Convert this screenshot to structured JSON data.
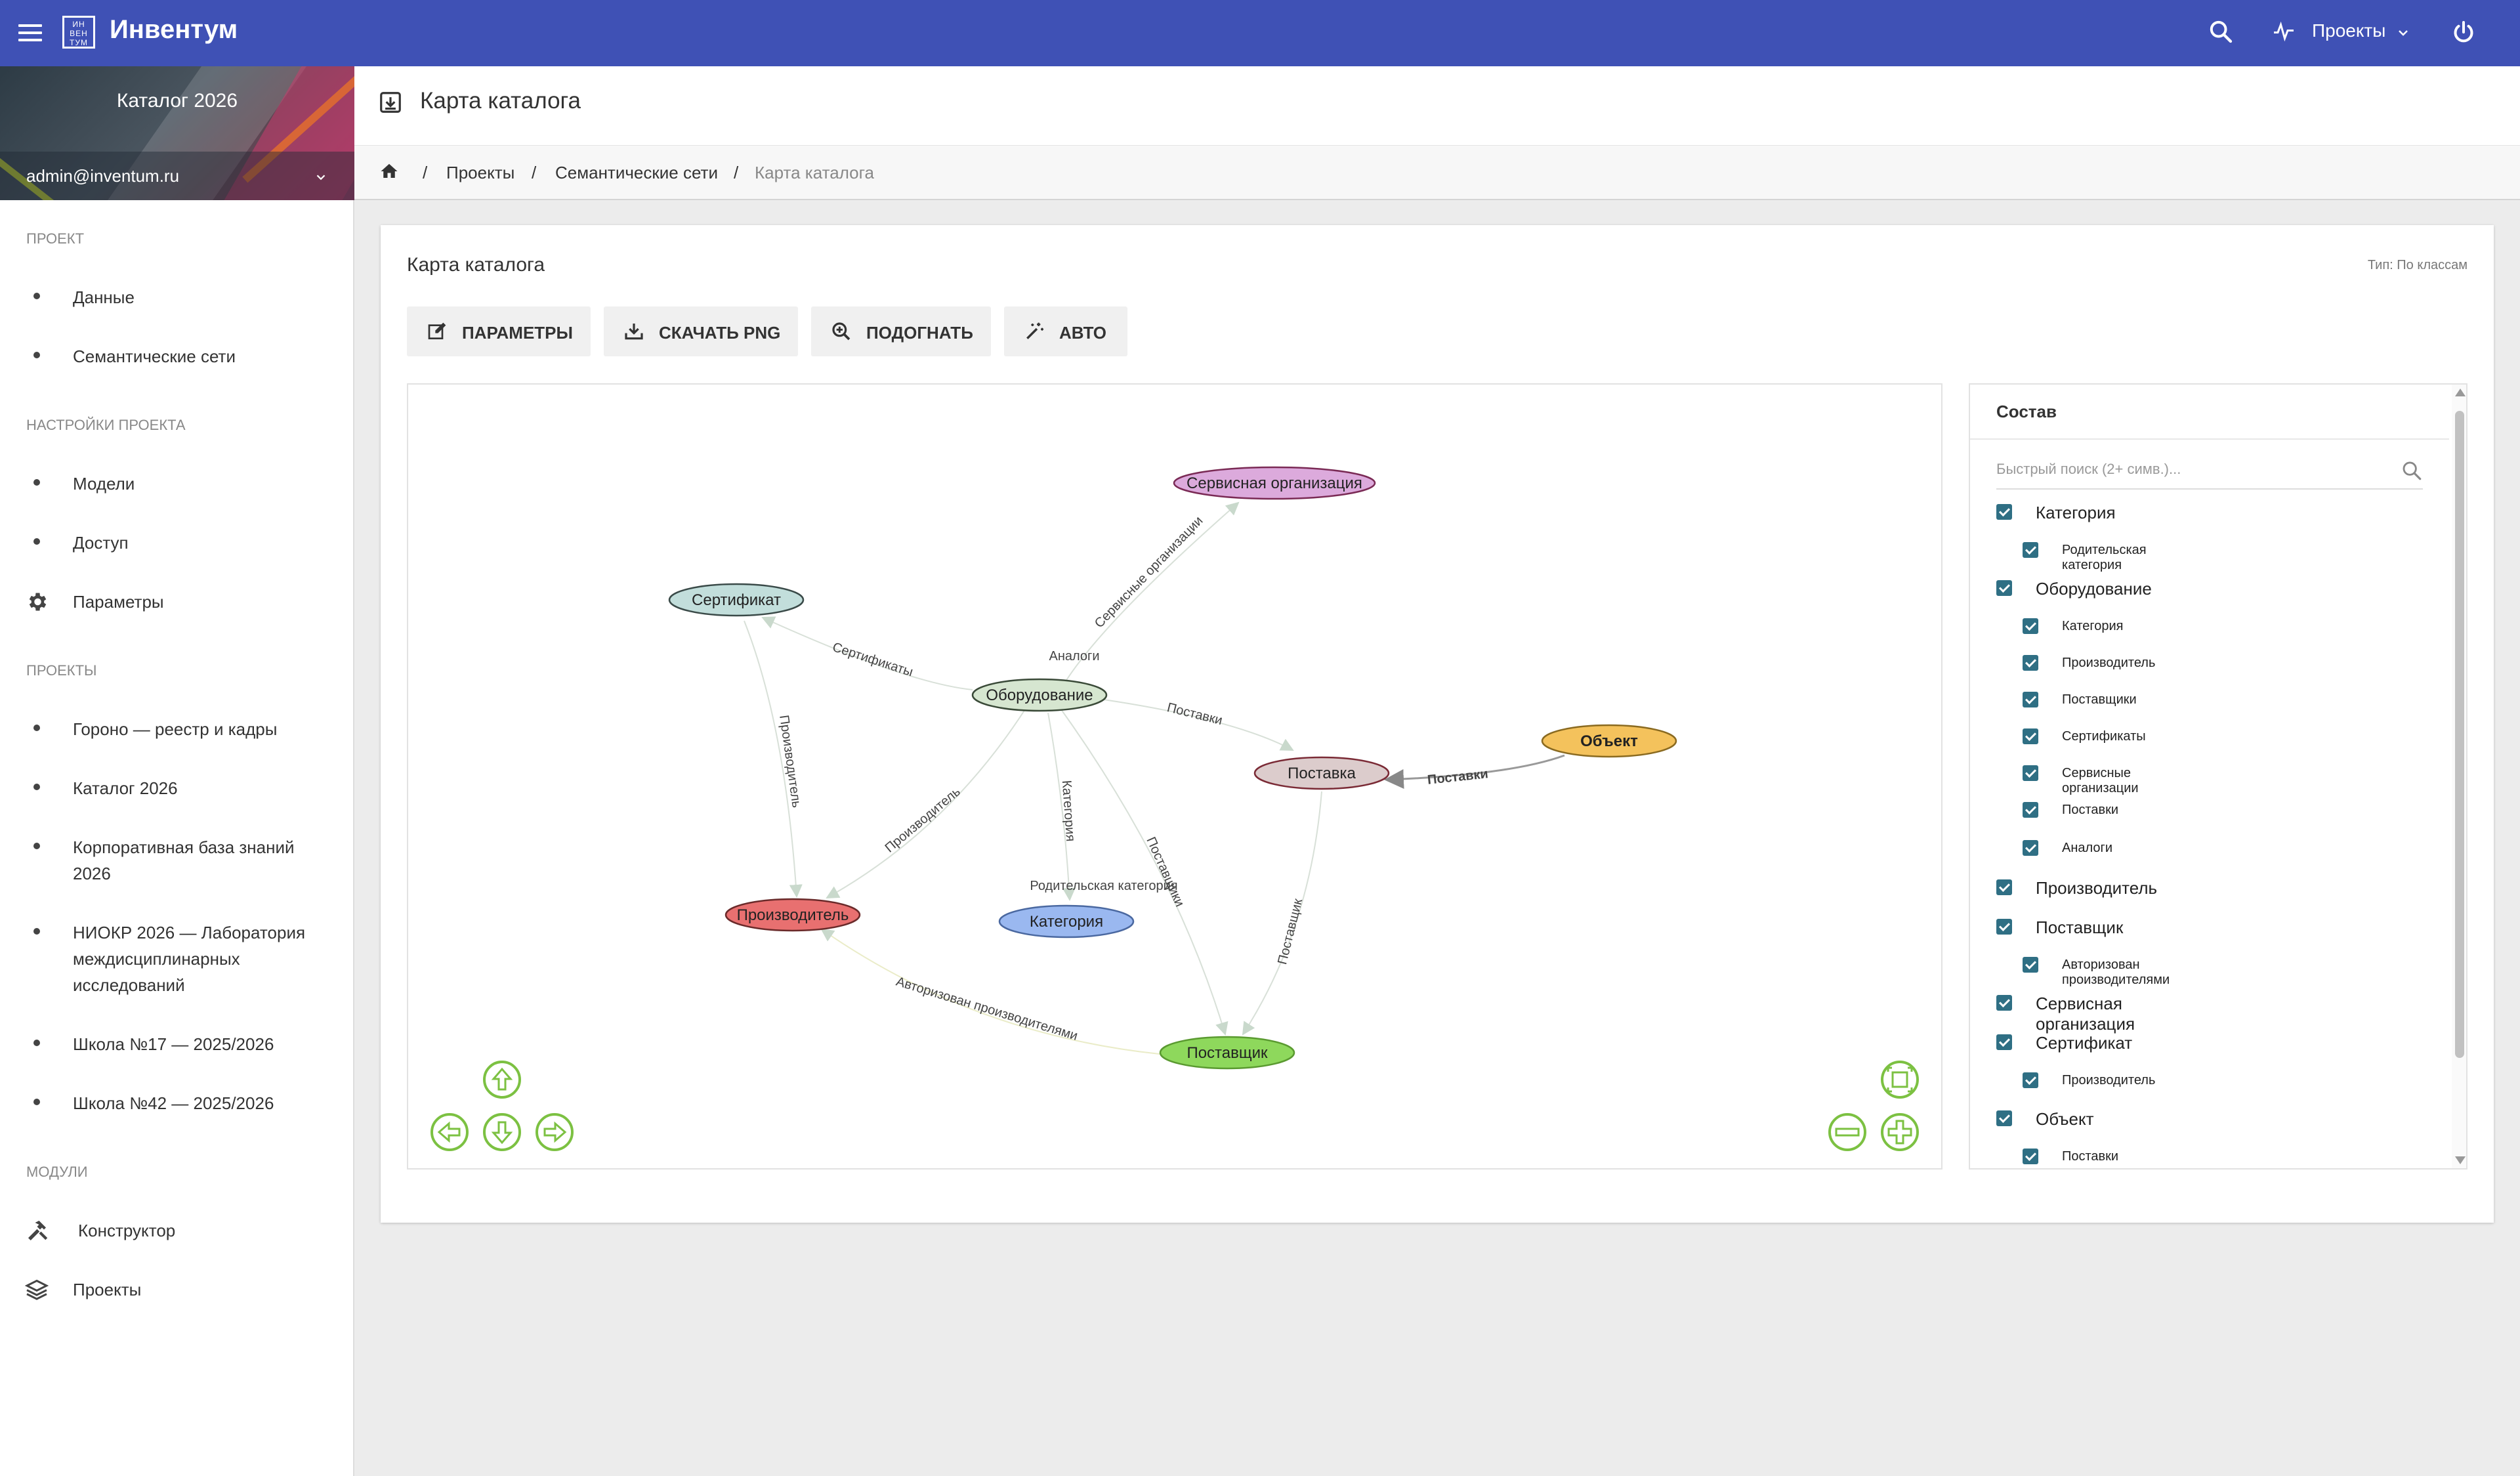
{
  "app": {
    "brand": "Инвентум",
    "logo_text": "ИН ВЕН ТУМ",
    "projects_label": "Проекты"
  },
  "sidebar": {
    "project_name": "Каталог 2026",
    "user_email": "admin@inventum.ru",
    "section_project": "Проект",
    "project_items": [
      "Данные",
      "Семантические сети"
    ],
    "section_settings": "Настройки проекта",
    "settings_items": [
      "Модели",
      "Доступ",
      "Параметры"
    ],
    "section_projects": "Проекты",
    "projects": [
      "Гороно — реестр и кадры",
      "Каталог 2026",
      "Корпоративная база знаний 2026",
      "НИОКР 2026 — Лаборатория междисциплинарных исследований",
      "Школа №17 — 2025/2026",
      "Школа №42 — 2025/2026"
    ],
    "section_modules": "Модули",
    "modules": [
      "Конструктор",
      "Проекты"
    ]
  },
  "page": {
    "title": "Карта каталога",
    "breadcrumbs": [
      "Проекты",
      "Семантические сети",
      "Карта каталога"
    ]
  },
  "card": {
    "title": "Карта каталога",
    "type_label": "Тип: По классам",
    "buttons": {
      "params": "Параметры",
      "download": "Скачать PNG",
      "fit": "Подогнать",
      "auto": "Авто"
    }
  },
  "graph": {
    "nodes": {
      "service_org": {
        "label": "Сервисная организация",
        "color": "#dcaadc"
      },
      "certificate": {
        "label": "Сертификат",
        "color": "#c2dedb"
      },
      "equipment": {
        "label": "Оборудование",
        "color": "#d6e6d0"
      },
      "object": {
        "label": "Объект",
        "color": "#f4c25c"
      },
      "supply": {
        "label": "Поставка",
        "color": "#dccccc"
      },
      "manufacturer": {
        "label": "Производитель",
        "color": "#e87070"
      },
      "category": {
        "label": "Категория",
        "color": "#9ab8f0"
      },
      "supplier": {
        "label": "Поставщик",
        "color": "#8ed85c"
      }
    },
    "edges": {
      "service": "Сервисные организации",
      "analogs": "Аналоги",
      "certificates": "Сертификаты",
      "supplies": "Поставки",
      "supplies_obj": "Поставки",
      "cert_manufacturer": "Производитель",
      "manufacturer": "Производитель",
      "category": "Категория",
      "parent_category": "Родительская категория",
      "suppliers": "Поставщики",
      "supplier": "Поставщик",
      "authorized": "Авторизован производителями"
    }
  },
  "panel": {
    "title": "Состав",
    "search_placeholder": "Быстрый поиск (2+ симв.)...",
    "tree": [
      {
        "label": "Категория",
        "level": 0
      },
      {
        "label": "Родительская категория",
        "level": 1
      },
      {
        "label": "Оборудование",
        "level": 0
      },
      {
        "label": "Категория",
        "level": 1
      },
      {
        "label": "Производитель",
        "level": 1
      },
      {
        "label": "Поставщики",
        "level": 1
      },
      {
        "label": "Сертификаты",
        "level": 1
      },
      {
        "label": "Сервисные организации",
        "level": 1
      },
      {
        "label": "Поставки",
        "level": 1
      },
      {
        "label": "Аналоги",
        "level": 1
      },
      {
        "label": "Производитель",
        "level": 0
      },
      {
        "label": "Поставщик",
        "level": 0
      },
      {
        "label": "Авторизован производителями",
        "level": 1
      },
      {
        "label": "Сервисная организация",
        "level": 0
      },
      {
        "label": "Сертификат",
        "level": 0
      },
      {
        "label": "Производитель",
        "level": 1
      },
      {
        "label": "Объект",
        "level": 0
      },
      {
        "label": "Поставки",
        "level": 1
      }
    ]
  },
  "colors": {
    "topbar": "#3f51b5",
    "checkbox": "#2f6f84",
    "nav_controls": "#7cc142"
  }
}
